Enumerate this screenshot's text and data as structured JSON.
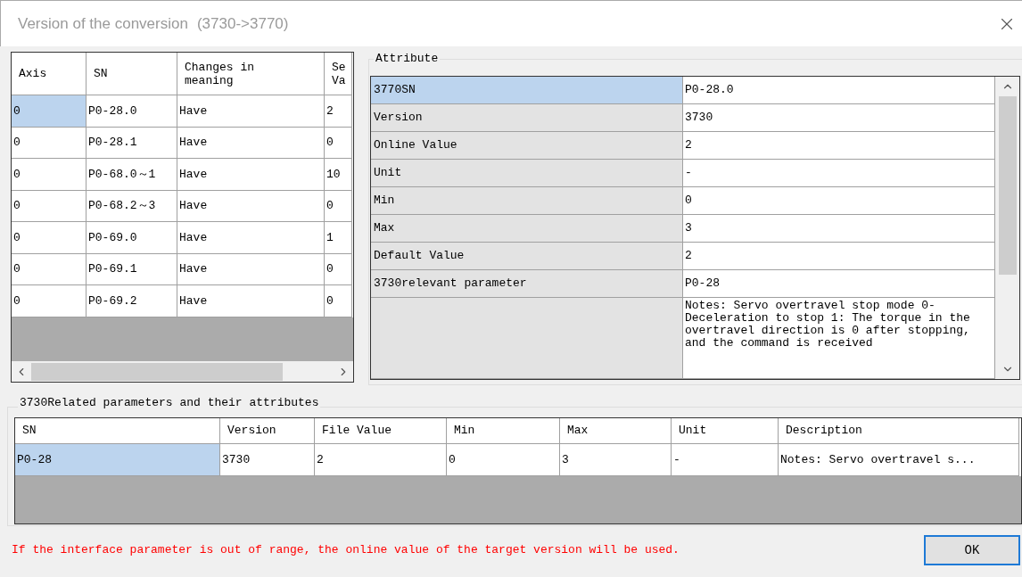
{
  "window": {
    "title": "Version of the conversion",
    "subtitle": "(3730->3770)"
  },
  "conversion_table": {
    "columns": [
      {
        "lines": [
          "Axis"
        ]
      },
      {
        "lines": [
          "SN"
        ]
      },
      {
        "lines": [
          "Changes in",
          "meaning"
        ]
      },
      {
        "lines": [
          "Se",
          "Va"
        ]
      }
    ],
    "rows": [
      {
        "selected": true,
        "cells": [
          "0",
          "P0-28.0",
          "Have",
          "2"
        ]
      },
      {
        "selected": false,
        "cells": [
          "0",
          "P0-28.1",
          "Have",
          "0"
        ]
      },
      {
        "selected": false,
        "cells": [
          "0",
          "P0-68.0～1",
          "Have",
          "10"
        ]
      },
      {
        "selected": false,
        "cells": [
          "0",
          "P0-68.2～3",
          "Have",
          "0"
        ]
      },
      {
        "selected": false,
        "cells": [
          "0",
          "P0-69.0",
          "Have",
          "1"
        ]
      },
      {
        "selected": false,
        "cells": [
          "0",
          "P0-69.1",
          "Have",
          "0"
        ]
      },
      {
        "selected": false,
        "cells": [
          "0",
          "P0-69.2",
          "Have",
          "0"
        ]
      }
    ]
  },
  "attribute": {
    "title": "Attribute",
    "rows": [
      {
        "label": "3770SN",
        "value": "P0-28.0",
        "selected": true
      },
      {
        "label": "Version",
        "value": "3730",
        "selected": false
      },
      {
        "label": "Online Value",
        "value": "2",
        "selected": false
      },
      {
        "label": "Unit",
        "value": "-",
        "selected": false
      },
      {
        "label": "Min",
        "value": "0",
        "selected": false
      },
      {
        "label": "Max",
        "value": "3",
        "selected": false
      },
      {
        "label": "Default Value",
        "value": "2",
        "selected": false
      },
      {
        "label": "3730relevant parameter",
        "value": "P0-28",
        "selected": false
      },
      {
        "value": "Notes: Servo overtravel stop mode 0-Deceleration to stop 1: The torque in the overtravel direction is 0 after stopping, and the command is received",
        "selected": false
      }
    ]
  },
  "related": {
    "title": "3730Related parameters and their attributes",
    "columns": [
      "SN",
      "Version",
      "File Value",
      "Min",
      "Max",
      "Unit",
      "Description"
    ],
    "rows": [
      {
        "selected": true,
        "cells": [
          "P0-28",
          "3730",
          "2",
          "0",
          "3",
          "-",
          "Notes: Servo overtravel s..."
        ]
      }
    ]
  },
  "footer": {
    "message": "If the interface parameter is out of range, the online value of the target version will be used.",
    "ok_button": "OK"
  }
}
